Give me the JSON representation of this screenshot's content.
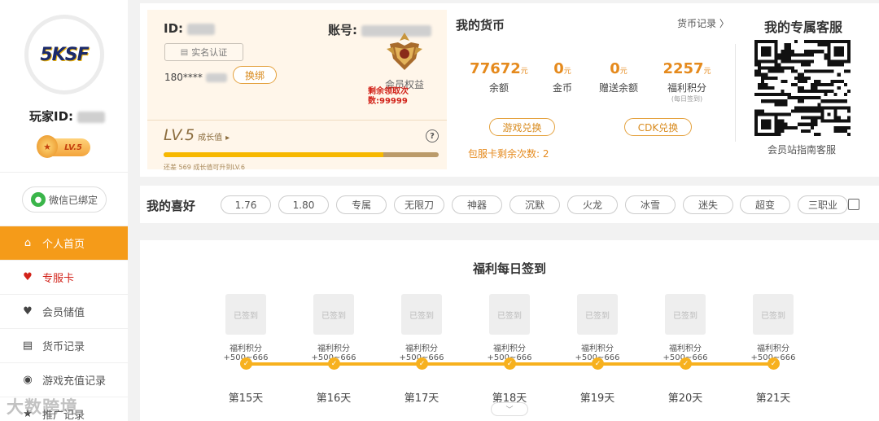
{
  "sidebar": {
    "avatar_logo": "5KSF",
    "player_id_label": "玩家ID:",
    "level_badge": "LV.5",
    "wechat_label": "微信已绑定",
    "items": [
      {
        "label": "个人首页",
        "icon": "home-icon",
        "active": true
      },
      {
        "label": "专服卡",
        "icon": "heart-card-icon",
        "active": false,
        "highlight": true
      },
      {
        "label": "会员储值",
        "icon": "heart-icon",
        "active": false
      },
      {
        "label": "货币记录",
        "icon": "ticket-icon",
        "active": false
      },
      {
        "label": "游戏充值记录",
        "icon": "gamepad-icon",
        "active": false
      },
      {
        "label": "推广记录",
        "icon": "star-icon",
        "active": false
      }
    ]
  },
  "account": {
    "id_label": "ID:",
    "account_label": "账号:",
    "realname_label": "实名认证",
    "phone": "180****",
    "rebind_label": "换绑",
    "member_label": "会员权益",
    "remain_text": "剩余领取次数:99999",
    "level": "LV.5",
    "growth_label": "成长值",
    "progress": 0.8,
    "progress_note": "还差 569 成长值可升到LV.6"
  },
  "wallet": {
    "title": "我的货币",
    "record_label": "货币记录",
    "stats": [
      {
        "value": "77672",
        "unit": "元",
        "label": "余额",
        "sub": ""
      },
      {
        "value": "0",
        "unit": "元",
        "label": "金币",
        "sub": ""
      },
      {
        "value": "0",
        "unit": "元",
        "label": "赠送余额",
        "sub": ""
      },
      {
        "value": "2257",
        "unit": "元",
        "label": "福利积分",
        "sub": "(每日签到)"
      }
    ],
    "game_exchange": "游戏兑换",
    "cdk_exchange": "CDK兑换",
    "bao_remaining": "包服卡剩余次数: 2"
  },
  "service": {
    "title": "我的专属客服",
    "label": "会员站指南客服"
  },
  "prefs": {
    "title": "我的喜好",
    "tags": [
      "1.76",
      "1.80",
      "专属",
      "无限刀",
      "神器",
      "沉默",
      "火龙",
      "冰雪",
      "迷失",
      "超变",
      "三职业"
    ]
  },
  "checkin": {
    "title": "福利每日签到",
    "days": [
      {
        "status": "已签到",
        "reward": "福利积分+500~666",
        "label": "第15天"
      },
      {
        "status": "已签到",
        "reward": "福利积分+500~666",
        "label": "第16天"
      },
      {
        "status": "已签到",
        "reward": "福利积分+500~666",
        "label": "第17天"
      },
      {
        "status": "已签到",
        "reward": "福利积分+500~666",
        "label": "第18天"
      },
      {
        "status": "已签到",
        "reward": "福利积分+500~666",
        "label": "第19天"
      },
      {
        "status": "已签到",
        "reward": "福利积分+500~666",
        "label": "第20天"
      },
      {
        "status": "已签到",
        "reward": "福利积分+500~666",
        "label": "第21天"
      }
    ]
  },
  "watermark": "大数跨境",
  "colors": {
    "accent": "#f59b19",
    "highlight": "#d2231a",
    "gold": "#e58a1d"
  }
}
